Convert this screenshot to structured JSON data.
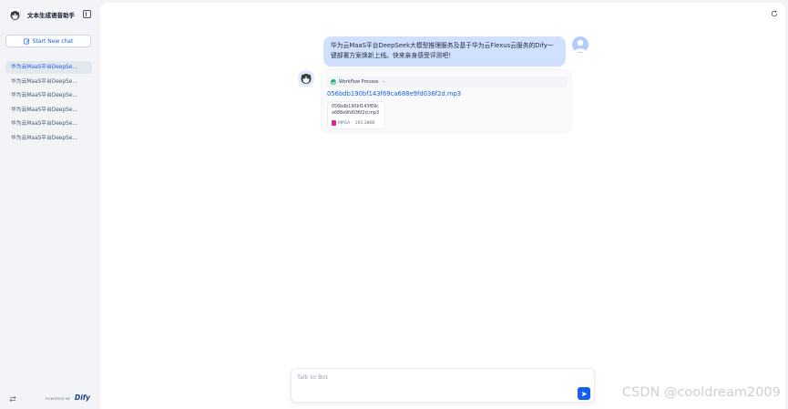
{
  "app": {
    "title": "文本生成语音助手",
    "new_chat_label": "Start New chat"
  },
  "conversations": [
    {
      "label": "华为云MaaS平台DeepSe...",
      "active": true
    },
    {
      "label": "华为云MaaS平台DeepSe...",
      "active": false
    },
    {
      "label": "华为云MaaS平台DeepSe...",
      "active": false
    },
    {
      "label": "华为云MaaS平台DeepSe...",
      "active": false
    },
    {
      "label": "华为云MaaS平台DeepSe...",
      "active": false
    },
    {
      "label": "华为云MaaS平台DeepSe...",
      "active": false
    }
  ],
  "footer": {
    "powered_by": "POWERED BY",
    "brand": "Dify"
  },
  "chat": {
    "user_message": "华为云MaaS平台DeepSeek大模型推理服务及基于华为云Flexus云服务的Dify一键部署方案焕新上线。快来亲身感受评测吧！",
    "workflow_label": "Workflow Process",
    "file_link": "056bdb190bf143f69ca688e9fd036f2d.mp3",
    "file_card_name": "056bdb190bf143f69ca688e9fd036f2d.mp3",
    "file_type": "MPGA",
    "file_size": "165.38KB"
  },
  "input": {
    "placeholder": "Talk to Bot"
  },
  "watermark": "CSDN @cooldream2009",
  "colors": {
    "accent": "#155eef",
    "user_bubble": "#d1e0ff",
    "success": "#12b76a"
  }
}
